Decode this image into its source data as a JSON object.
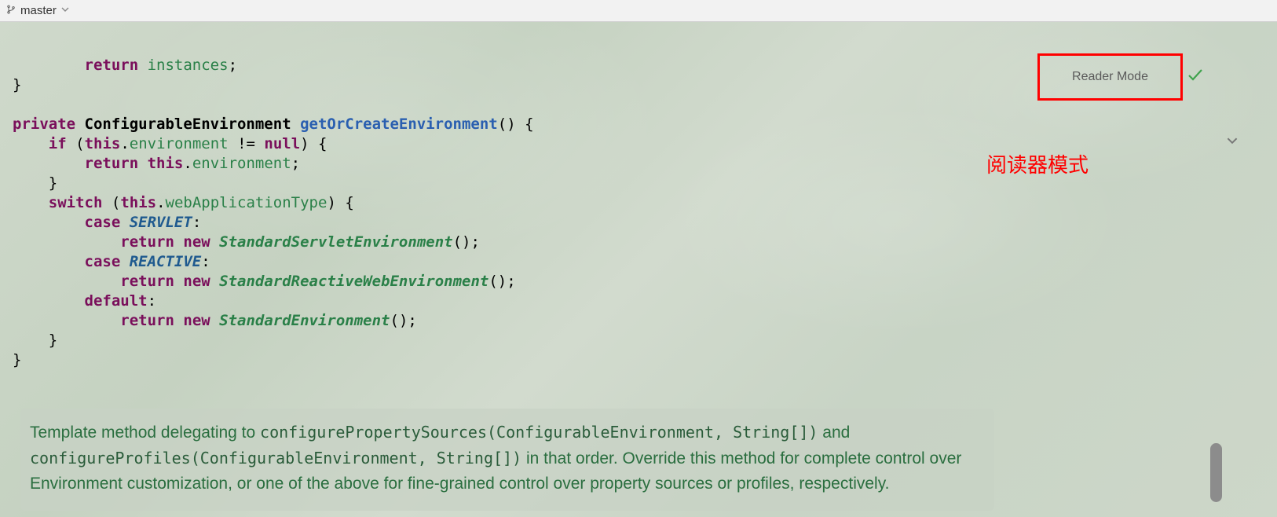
{
  "topbar": {
    "branch_name": "master"
  },
  "reader_mode": {
    "label": "Reader Mode"
  },
  "annotation": {
    "text": "阅读器模式"
  },
  "code": {
    "l1_kw_return": "return",
    "l1_ident": "instances",
    "l2_brace": "}",
    "l4_kw_private": "private",
    "l4_type": "ConfigurableEnvironment",
    "l4_method": "getOrCreateEnvironment",
    "l5_kw_if": "if",
    "l5_kw_this": "this",
    "l5_field_env": "environment",
    "l5_kw_null": "null",
    "l6_kw_return": "return",
    "l6_kw_this": "this",
    "l6_field_env": "environment",
    "l7_brace": "}",
    "l8_kw_switch": "switch",
    "l8_kw_this": "this",
    "l8_field_wat": "webApplicationType",
    "l9_kw_case": "case",
    "l9_const": "SERVLET",
    "l10_kw_return": "return",
    "l10_kw_new": "new",
    "l10_type": "StandardServletEnvironment",
    "l11_kw_case": "case",
    "l11_const": "REACTIVE",
    "l12_kw_return": "return",
    "l12_kw_new": "new",
    "l12_type": "StandardReactiveWebEnvironment",
    "l13_kw_default": "default",
    "l14_kw_return": "return",
    "l14_kw_new": "new",
    "l14_type": "StandardEnvironment",
    "l15_brace": "}",
    "l16_brace": "}"
  },
  "doc": {
    "part1": "Template method delegating to ",
    "ref1": "configurePropertySources(ConfigurableEnvironment, String[])",
    "part2": " and ",
    "ref2": "configureProfiles(ConfigurableEnvironment, String[])",
    "part3": " in that order. Override this method for complete control over Environment customization, or one of the above for fine-grained control over property sources or profiles, respectively."
  }
}
